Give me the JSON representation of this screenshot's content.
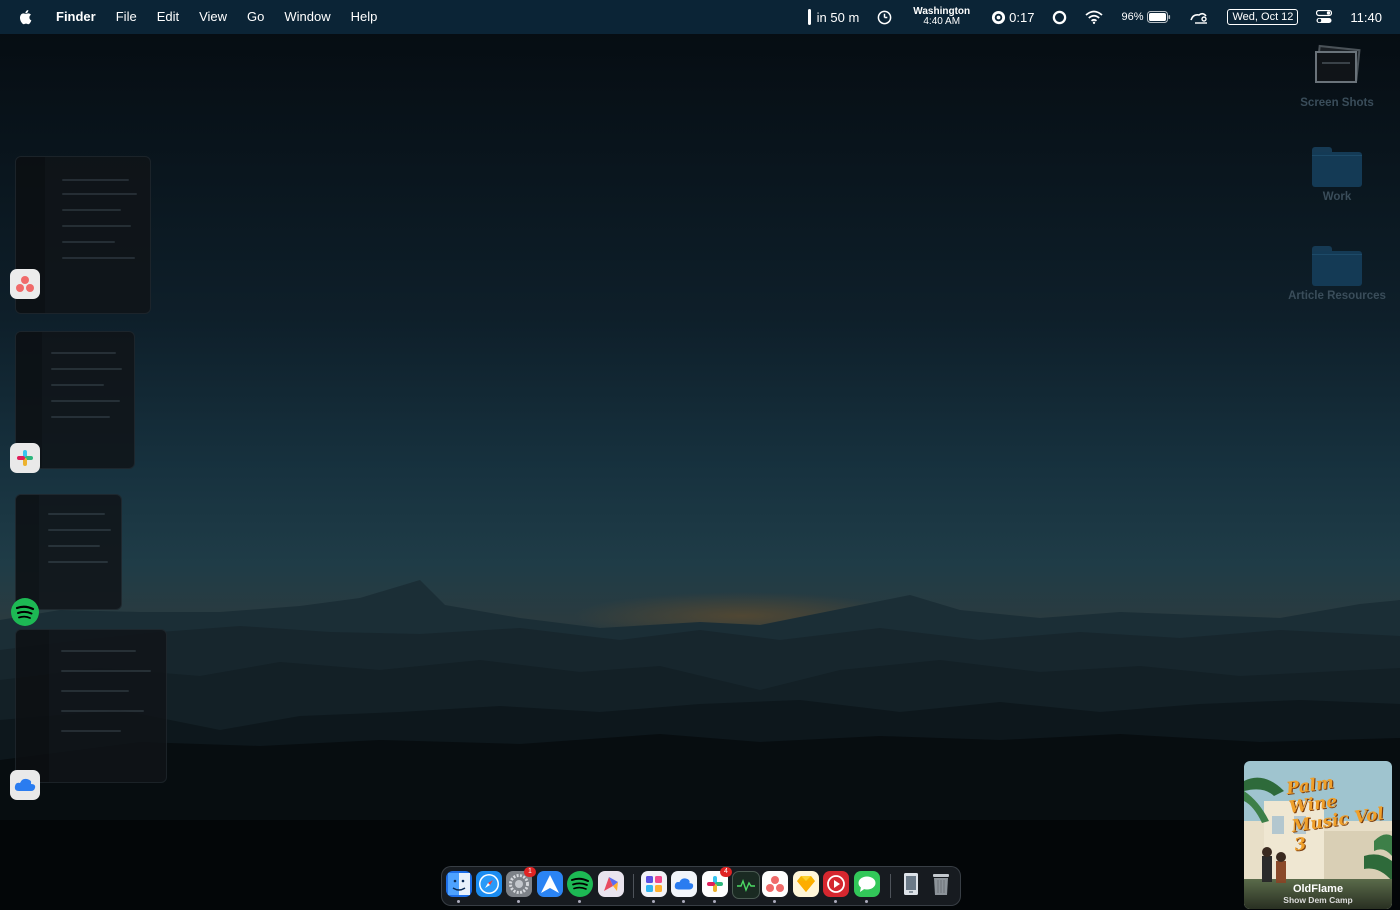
{
  "menubar": {
    "app_name": "Finder",
    "menus": [
      "File",
      "Edit",
      "View",
      "Go",
      "Window",
      "Help"
    ],
    "calendar_next": "in 50 m",
    "world_clock_city": "Washington",
    "world_clock_time": "4:40 AM",
    "timer": "0:17",
    "battery_percent": "96%",
    "date": "Wed, Oct 12",
    "time": "11:40"
  },
  "desktop": {
    "icons": [
      {
        "label": "Screen Shots"
      },
      {
        "label": "Work"
      },
      {
        "label": "Article Resources"
      }
    ]
  },
  "stage_manager": {
    "groups": [
      {
        "app_icon": "asana-icon"
      },
      {
        "app_icon": "slack-icon"
      },
      {
        "app_icon": "spotify-icon"
      },
      {
        "app_icon": "icloud-icon"
      }
    ]
  },
  "dock": {
    "apps": [
      {
        "name": "finder-icon",
        "color": "#1e6fe8"
      },
      {
        "name": "safari-icon",
        "color": "#1b8cf0"
      },
      {
        "name": "system-settings-icon",
        "color": "#7d8288",
        "badge": "1"
      },
      {
        "name": "spark-mail-icon",
        "color": "#2b84f4"
      },
      {
        "name": "spotify-icon",
        "color": "#1db954"
      },
      {
        "name": "craft-icon",
        "color": "#e84a5f"
      },
      {
        "name": "notion-calendar-icon",
        "color": "#5b4fe0"
      },
      {
        "name": "icloud-icon",
        "color": "#2a7cf0"
      },
      {
        "name": "slack-icon",
        "color": "#ffffff",
        "badge": "4"
      },
      {
        "name": "activity-monitor-icon",
        "color": "#1a2a22"
      },
      {
        "name": "asana-icon",
        "color": "#f06a6a"
      },
      {
        "name": "sketch-icon",
        "color": "#f7b400"
      },
      {
        "name": "screen-recorder-icon",
        "color": "#d5272f"
      },
      {
        "name": "messages-icon",
        "color": "#32c759"
      },
      {
        "name": "preview-icon",
        "color": "#dde2e8"
      },
      {
        "name": "trash-icon",
        "color": "#8c9399"
      }
    ]
  },
  "now_playing": {
    "track": "OldFlame",
    "artist": "Show Dem Camp",
    "album_art_text": "Palm Wine Music Vol 3",
    "accent": "#f0a02a"
  }
}
